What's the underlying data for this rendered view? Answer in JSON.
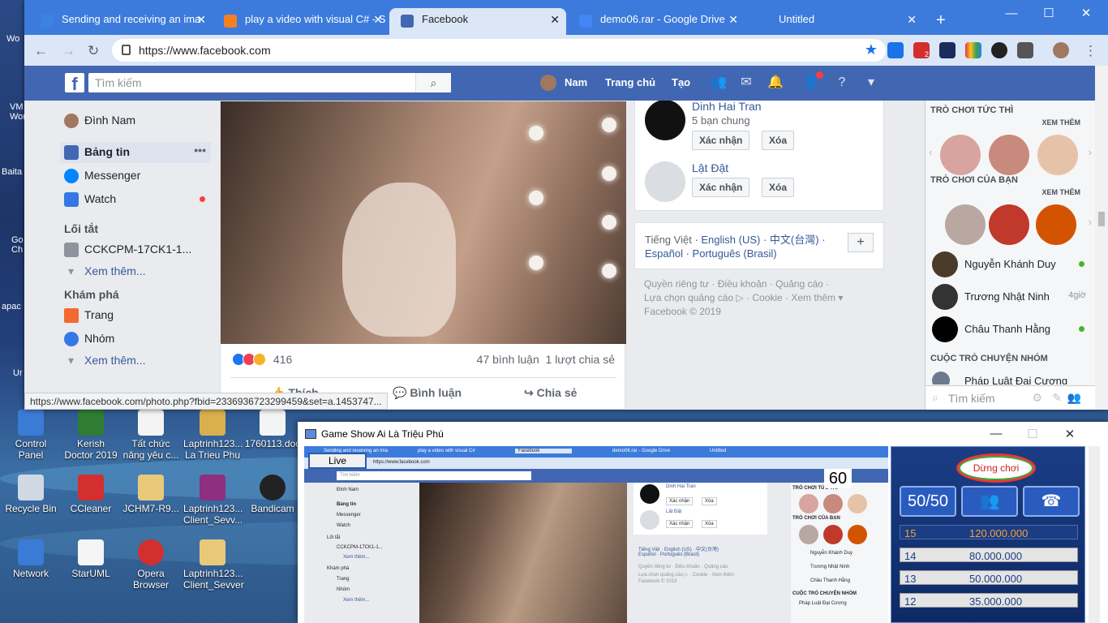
{
  "desktop": {
    "icons": [
      {
        "label": "Control Panel",
        "color": "#3a7bd5"
      },
      {
        "label": "Kerish Doctor 2019",
        "color": "#2e7d32"
      },
      {
        "label": "Tất chức năng yêu c...",
        "color": "#f4f4f4"
      },
      {
        "label": "Laptrinh123... La Trieu Phu",
        "color": "#d9b04b"
      },
      {
        "label": "1760113.doc",
        "color": "#f4f4f4"
      },
      {
        "label": "Recycle Bin",
        "color": "#cfd8e3"
      },
      {
        "label": "CCleaner",
        "color": "#d32f2f"
      },
      {
        "label": "JCHM7-R9...",
        "color": "#e8c97a"
      },
      {
        "label": "Laptrinh123... Client_Sevv...",
        "color": "#8e2f7f"
      },
      {
        "label": "Bandicam",
        "color": "#222222"
      },
      {
        "label": "Network",
        "color": "#3a7bd5"
      },
      {
        "label": "StarUML",
        "color": "#f5f5f5"
      },
      {
        "label": "Opera Browser",
        "color": "#d32f2f"
      },
      {
        "label": "Laptrinh123... Client_Sevver",
        "color": "#e8c97a"
      }
    ],
    "left_edge_labels": [
      "Wo",
      "VM Wor",
      "Baita",
      "Go Ch",
      "apac",
      "Ur"
    ]
  },
  "browser": {
    "tabs": [
      {
        "label": "Sending and receiving an ima",
        "favicon": "#3d82e0"
      },
      {
        "label": "play a video with visual C# - S",
        "favicon": "#f48024"
      },
      {
        "label": "Facebook",
        "favicon": "#4267b2"
      },
      {
        "label": "demo06.rar - Google Drive",
        "favicon": "#4285f4"
      },
      {
        "label": "Untitled",
        "favicon": ""
      }
    ],
    "new_tab": "+",
    "url": "https://www.facebook.com",
    "status_url": "https://www.facebook.com/photo.php?fbid=2336936723299459&set=a.1453747...",
    "ext_badge": "2"
  },
  "facebook": {
    "search_placeholder": "Tìm kiếm",
    "nav": {
      "profile": "Nam",
      "home": "Trang chủ",
      "create": "Tạo"
    },
    "left": {
      "profile": "Đình Nam",
      "items": [
        {
          "label": "Bảng tin",
          "icon": "news-feed-icon",
          "more": "•••"
        },
        {
          "label": "Messenger",
          "icon": "messenger-icon"
        },
        {
          "label": "Watch",
          "icon": "watch-icon"
        }
      ],
      "shortcuts_title": "Lối tắt",
      "shortcut": "CCKCPM-17CK1-1...",
      "see_more": "Xem thêm...",
      "explore_title": "Khám phá",
      "explore": [
        "Trang",
        "Nhóm"
      ]
    },
    "post": {
      "reaction_count": "416",
      "comments": "47 bình luận",
      "shares": "1 lượt chia sẻ",
      "like": "Thích",
      "comment": "Bình luận",
      "share": "Chia sẻ"
    },
    "friend_requests": [
      {
        "name": "Dinh Hai Tran",
        "mutual": "5 bạn chung",
        "confirm": "Xác nhận",
        "delete": "Xóa"
      },
      {
        "name": "Lật Đật",
        "mutual": "",
        "confirm": "Xác nhận",
        "delete": "Xóa"
      }
    ],
    "languages": {
      "line1": [
        "Tiếng Việt",
        "English (US)",
        "中文(台灣)"
      ],
      "line2": [
        "Español",
        "Português (Brasil)"
      ],
      "add": "+"
    },
    "footer": {
      "line1": "Quyền riêng tư · Điều khoản · Quảng cáo ·",
      "line2": "Lựa chọn quảng cáo ▷ · Cookie · Xem thêm ▾",
      "copyright": "Facebook © 2019"
    },
    "chat": {
      "instant_games": "TRÒ CHƠI TỨC THÌ",
      "see_more": "XEM THÊM",
      "your_games": "TRÒ CHƠI CỦA BẠN",
      "contacts": [
        {
          "name": "Nguyễn Khánh Duy",
          "status": "online"
        },
        {
          "name": "Trương Nhật Ninh",
          "status": "4giờ"
        },
        {
          "name": "Châu Thanh Hằng",
          "status": "online"
        }
      ],
      "group_title": "CUỘC TRÒ CHUYỆN NHÓM",
      "group": "Pháp Luật Đại Cương",
      "search": "Tìm kiếm"
    }
  },
  "game": {
    "title": "Game Show Ai Là Triệu Phú",
    "live": "Live",
    "timer": "60",
    "stop": "Dừng chơi",
    "lifelines": [
      "50/50",
      "",
      ""
    ],
    "prizes": [
      {
        "level": "15",
        "amount": "120.000.000"
      },
      {
        "level": "14",
        "amount": "80.000.000"
      },
      {
        "level": "13",
        "amount": "50.000.000"
      },
      {
        "level": "12",
        "amount": "35.000.000"
      }
    ],
    "mini": {
      "tabs": [
        "Sending and receiving an ima",
        "play a video with visual C#",
        "Facebook",
        "demo06.rar - Google Drive",
        "Untitled"
      ],
      "url": "https://www.facebook.com",
      "search": "Tìm kiếm",
      "profile": "Đình Nam",
      "items": [
        "Bảng tin",
        "Messenger",
        "Watch",
        "Lối tắt",
        "CCKCPM-17CK1-1...",
        "Xem thêm...",
        "Khám phá",
        "Trang",
        "Nhóm",
        "Xem thêm..."
      ],
      "friend1": "Dinh Hai Tran",
      "friend2": "Lật Đật",
      "confirm": "Xác nhận",
      "delete": "Xóa",
      "langs": "Tiếng Việt · English (US) · 中文(台灣)",
      "langs2": "Español · Português (Brasil)",
      "foot1": "Quyền riêng tư · Điều khoản · Quảng cáo",
      "foot2": "Lựa chọn quảng cáo ▷ · Cookie · Xem thêm",
      "foot3": "Facebook © 2019",
      "games": "TRÒ CHƠI TỨC THÌ",
      "your_games": "TRÒ CHƠI CỦA BẠN",
      "contacts": [
        "Nguyễn Khánh Duy",
        "Trương Nhật Ninh",
        "Châu Thanh Hằng"
      ],
      "group_title": "CUỘC TRÒ CHUYỆN NHÓM",
      "group": "Pháp Luật Đại Cương"
    }
  }
}
